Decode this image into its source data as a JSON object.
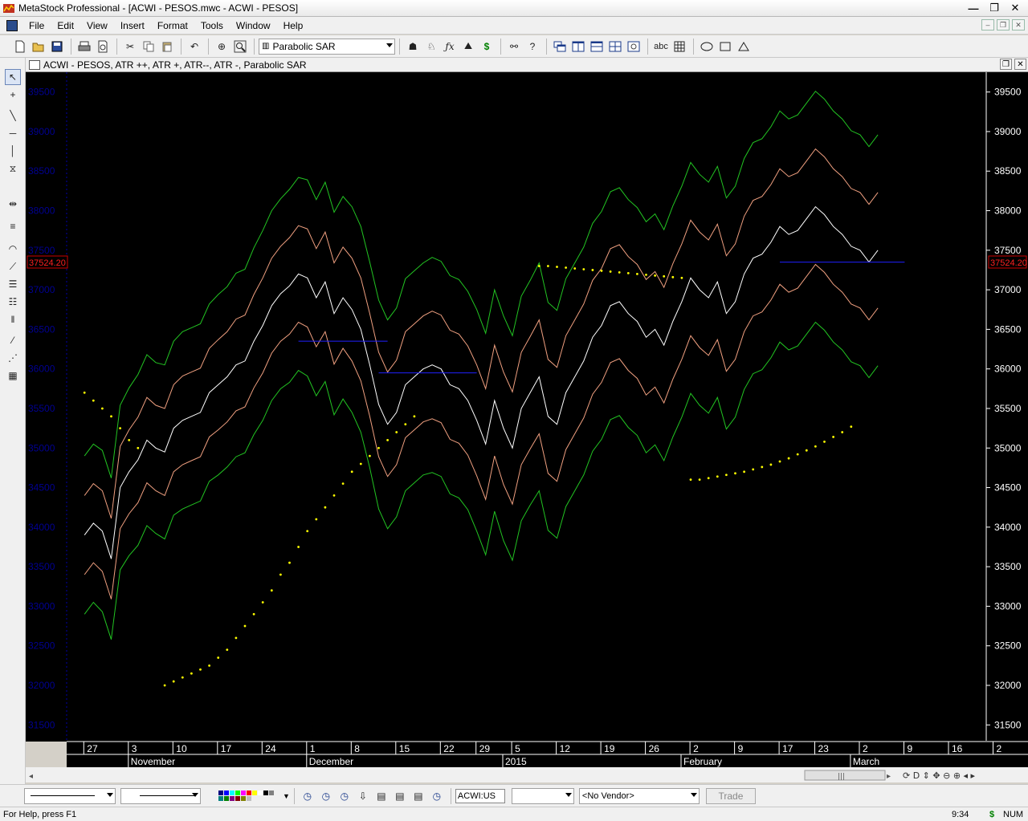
{
  "window": {
    "title": "MetaStock Professional - [ACWI - PESOS.mwc - ACWI - PESOS]",
    "minimize": "—",
    "restore": "❐",
    "close": "✕"
  },
  "menu": {
    "items": [
      "File",
      "Edit",
      "View",
      "Insert",
      "Format",
      "Tools",
      "Window",
      "Help"
    ]
  },
  "toolbar": {
    "indicator_select": "Parabolic SAR"
  },
  "chart_window": {
    "title": "ACWI - PESOS, ATR ++, ATR +, ATR--, ATR -, Parabolic SAR",
    "price_tag": "37524.20"
  },
  "bottom": {
    "symbol_value": "ACWI:US",
    "vendor_select": "<No Vendor>",
    "trade_label": "Trade",
    "palette": [
      "#000080",
      "#0000ff",
      "#00ffff",
      "#00ff00",
      "#ff00ff",
      "#ff0000",
      "#ffff00",
      "#ffffff",
      "#000000",
      "#808080",
      "#008080",
      "#008000",
      "#800080",
      "#800000",
      "#808000",
      "#c0c0c0"
    ]
  },
  "status": {
    "help": "For Help, press F1",
    "time": "9:34",
    "dollar": "$",
    "num": "NUM"
  },
  "chart_data": {
    "type": "line",
    "ylim": [
      31300,
      39750
    ],
    "y_ticks": [
      31500,
      32000,
      32500,
      33000,
      33500,
      34000,
      34500,
      35000,
      35500,
      36000,
      36500,
      37000,
      37500,
      38000,
      38500,
      39000,
      39500
    ],
    "x_day_ticks": [
      {
        "label": "27",
        "i": 1
      },
      {
        "label": "3",
        "i": 6
      },
      {
        "label": "10",
        "i": 11
      },
      {
        "label": "17",
        "i": 16
      },
      {
        "label": "24",
        "i": 21
      },
      {
        "label": "1",
        "i": 26
      },
      {
        "label": "8",
        "i": 31
      },
      {
        "label": "15",
        "i": 36
      },
      {
        "label": "22",
        "i": 41
      },
      {
        "label": "29",
        "i": 45
      },
      {
        "label": "5",
        "i": 49
      },
      {
        "label": "12",
        "i": 54
      },
      {
        "label": "19",
        "i": 59
      },
      {
        "label": "26",
        "i": 64
      },
      {
        "label": "2",
        "i": 69
      },
      {
        "label": "9",
        "i": 74
      },
      {
        "label": "17",
        "i": 79
      },
      {
        "label": "23",
        "i": 83
      },
      {
        "label": "2",
        "i": 88
      },
      {
        "label": "9",
        "i": 93
      },
      {
        "label": "16",
        "i": 98
      },
      {
        "label": "2",
        "i": 103
      }
    ],
    "x_month_ticks": [
      {
        "label": "November",
        "i": 6
      },
      {
        "label": "December",
        "i": 26
      },
      {
        "label": "2015",
        "i": 48
      },
      {
        "label": "February",
        "i": 68
      },
      {
        "label": "March",
        "i": 87
      }
    ],
    "close": [
      33900,
      34050,
      33950,
      33600,
      34500,
      34700,
      34850,
      35100,
      35000,
      34950,
      35250,
      35350,
      35400,
      35450,
      35700,
      35800,
      35900,
      36050,
      36100,
      36350,
      36550,
      36800,
      36950,
      37050,
      37200,
      37150,
      36900,
      37100,
      36700,
      36900,
      36750,
      36500,
      36050,
      35550,
      35300,
      35450,
      35800,
      35900,
      36000,
      36050,
      36000,
      35800,
      35750,
      35600,
      35350,
      35050,
      35600,
      35250,
      35000,
      35500,
      35700,
      35900,
      35400,
      35300,
      35700,
      35900,
      36100,
      36400,
      36550,
      36800,
      36850,
      36700,
      36600,
      36400,
      36500,
      36300,
      36600,
      36850,
      37150,
      37000,
      36900,
      37100,
      36700,
      36850,
      37200,
      37400,
      37450,
      37600,
      37800,
      37700,
      37750,
      37900,
      38050,
      37950,
      37800,
      37700,
      37550,
      37500,
      37350,
      37500
    ],
    "atr_inner": [
      500,
      500,
      510,
      510,
      520,
      530,
      540,
      540,
      540,
      550,
      550,
      560,
      560,
      560,
      560,
      570,
      570,
      580,
      580,
      590,
      600,
      600,
      600,
      610,
      610,
      620,
      620,
      630,
      640,
      640,
      650,
      650,
      650,
      660,
      660,
      660,
      670,
      670,
      670,
      680,
      680,
      690,
      690,
      690,
      700,
      700,
      700,
      710,
      710,
      710,
      710,
      720,
      720,
      720,
      720,
      720,
      720,
      720,
      720,
      720,
      720,
      720,
      720,
      730,
      730,
      730,
      730,
      730,
      730,
      730,
      730,
      730,
      730,
      730,
      730,
      730,
      730,
      730,
      730,
      730,
      730,
      730,
      730,
      730,
      730,
      730,
      730,
      730,
      730,
      730
    ],
    "sar_segments": [
      {
        "start": 0,
        "values": [
          35700,
          35600,
          35500,
          35400,
          35250,
          35100,
          35000
        ]
      },
      {
        "start": 9,
        "values": [
          32000,
          32050,
          32100,
          32150,
          32200,
          32250,
          32350,
          32450,
          32600,
          32750,
          32900,
          33050,
          33200,
          33400,
          33550,
          33750,
          33950,
          34100,
          34250,
          34400,
          34550,
          34700,
          34800,
          34900,
          35000,
          35100,
          35200,
          35300,
          35400
        ]
      },
      {
        "start": 51,
        "values": [
          37300,
          37300,
          37290,
          37280,
          37270,
          37260,
          37250,
          37240,
          37230,
          37220,
          37210,
          37200,
          37190,
          37180,
          37170,
          37160,
          37150
        ]
      },
      {
        "start": 68,
        "values": [
          34600,
          34600,
          34620,
          34640,
          34660,
          34680,
          34700,
          34730,
          34760,
          34790,
          34830,
          34870,
          34920,
          34970,
          35020,
          35080,
          35140,
          35200,
          35270
        ]
      }
    ],
    "ref_lines": [
      {
        "from": 24,
        "to": 34,
        "value": 36350
      },
      {
        "from": 33,
        "to": 44,
        "value": 35950
      },
      {
        "from": 78,
        "to": 92,
        "value": 37350
      }
    ]
  }
}
